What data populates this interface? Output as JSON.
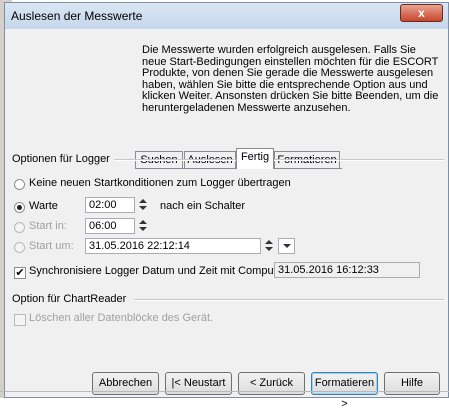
{
  "window": {
    "title": "Auslesen der Messwerte",
    "close_label": "x"
  },
  "info_text": "Die Messwerte wurden erfolgreich ausgelesen. Falls Sie neue Start-Bedingungen einstellen möchten für die ESCORT Produkte, von denen Sie gerade die Messwerte ausgelesen haben, wählen Sie bitte die entsprechende Option aus und klicken Weiter. Ansonsten drücken Sie bitte Beenden, um die heruntergeladenen Messwerte anzusehen.",
  "tabs": [
    {
      "label": "Suchen"
    },
    {
      "label": "Auslesen"
    },
    {
      "label": "Fertig"
    },
    {
      "label": "Formatieren"
    }
  ],
  "logger_options": {
    "group_title": "Optionen für Logger",
    "option_none": "Keine neuen Startkonditionen zum Logger übertragen",
    "option_wait": "Warte",
    "wait_value": "02:00",
    "wait_suffix": "nach ein Schalter",
    "option_start_in": "Start in:",
    "start_in_value": "06:00",
    "option_start_at": "Start um:",
    "start_at_value": "31.05.2016  22:12:14",
    "sync_label": "Synchronisiere Logger Datum und Zeit mit Computer.",
    "sync_checked": true,
    "sync_value": "31.05.2016  16:12:33"
  },
  "chartreader": {
    "group_title": "Option für ChartReader",
    "delete_label": "Löschen aller Datenblöcke des Gerät."
  },
  "buttons": {
    "cancel": "Abbrechen",
    "restart": "|< Neustart",
    "back": "< Zurück",
    "next": "Formatieren >",
    "help": "Hilfe"
  }
}
